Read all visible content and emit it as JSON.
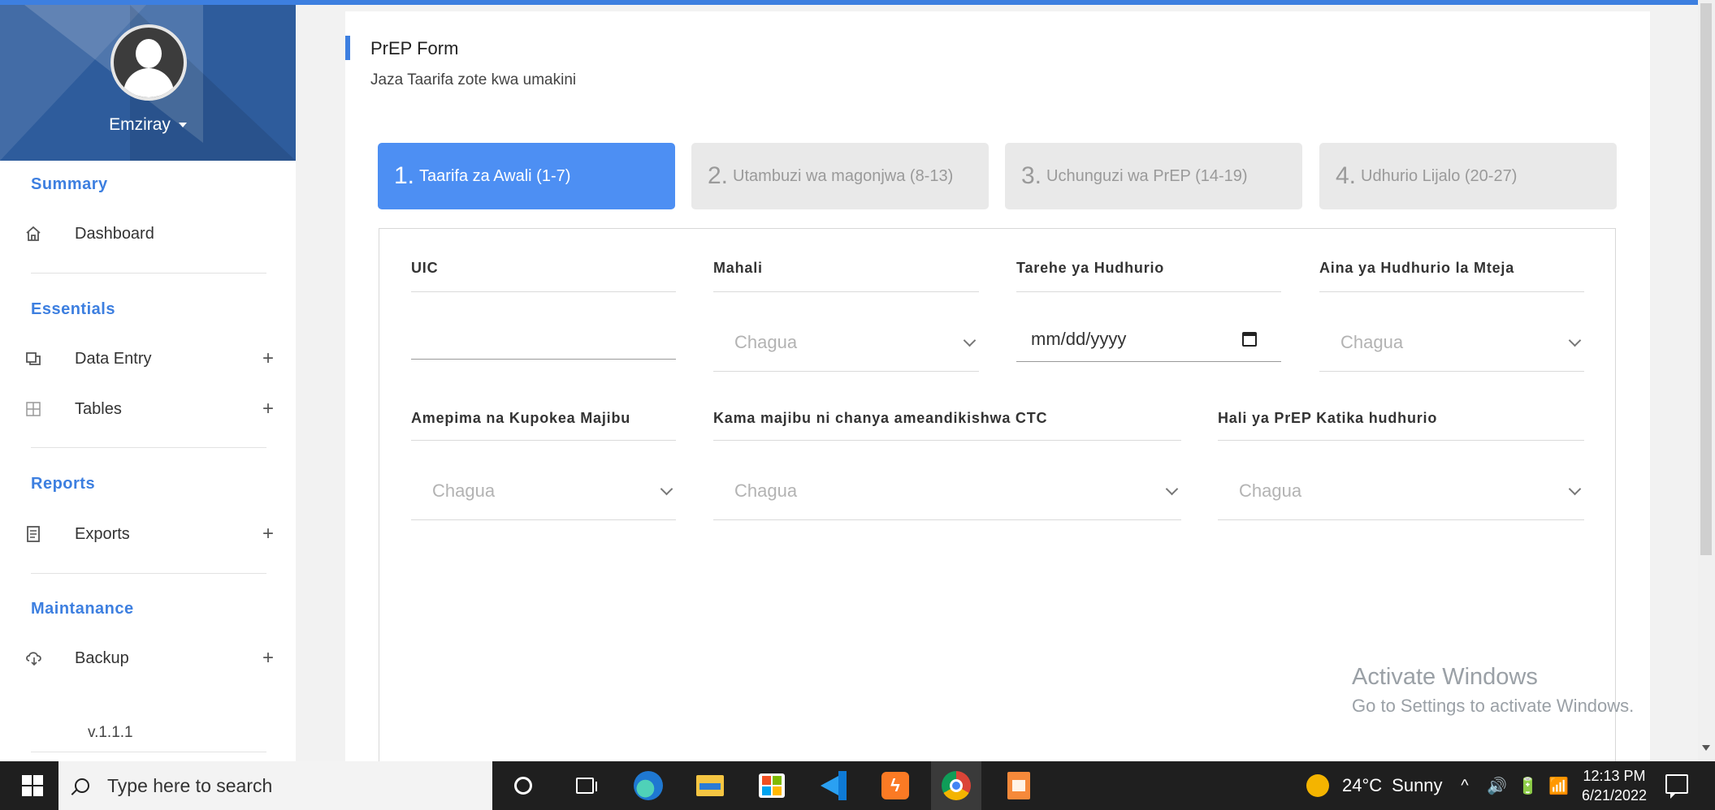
{
  "colors": {
    "accent": "#3d7fe0",
    "step_active": "#4d8ff3",
    "sidebar_profile_bg": "#2e5c9c",
    "taskbar_bg": "#1f1f1f"
  },
  "sidebar": {
    "username": "Emziray",
    "version": "v.1.1.1",
    "sections": [
      {
        "title": "Summary",
        "items": [
          {
            "label": "Dashboard",
            "icon": "home-icon",
            "expandable": false
          }
        ]
      },
      {
        "title": "Essentials",
        "items": [
          {
            "label": "Data Entry",
            "icon": "copy-icon",
            "expandable": true
          },
          {
            "label": "Tables",
            "icon": "table-icon",
            "expandable": true
          }
        ]
      },
      {
        "title": "Reports",
        "items": [
          {
            "label": "Exports",
            "icon": "document-icon",
            "expandable": true
          }
        ]
      },
      {
        "title": "Maintanance",
        "items": [
          {
            "label": "Backup",
            "icon": "cloud-icon",
            "expandable": true
          }
        ]
      }
    ],
    "expand_symbol": "+"
  },
  "header": {
    "title": "PrEP Form",
    "subtitle": "Jaza Taarifa zote kwa umakini"
  },
  "steps": [
    {
      "num": "1.",
      "label": "Taarifa za Awali (1-7)",
      "active": true
    },
    {
      "num": "2.",
      "label": "Utambuzi wa magonjwa (8-13)",
      "active": false
    },
    {
      "num": "3.",
      "label": "Uchunguzi wa PrEP (14-19)",
      "active": false
    },
    {
      "num": "4.",
      "label": "Udhurio Lijalo (20-27)",
      "active": false
    }
  ],
  "form": {
    "uic": {
      "label": "UIC",
      "value": ""
    },
    "mahali": {
      "label": "Mahali",
      "value": "Chagua"
    },
    "tarehe": {
      "label": "Tarehe ya Hudhurio",
      "value": "mm/dd/yyyy"
    },
    "aina": {
      "label": "Aina ya Hudhurio la Mteja",
      "value": "Chagua"
    },
    "amepima": {
      "label": "Amepima na Kupokea Majibu",
      "value": "Chagua"
    },
    "kama": {
      "label": "Kama majibu ni chanya ameandikishwa CTC",
      "value": "Chagua"
    },
    "hali": {
      "label": "Hali ya PrEP Katika hudhurio",
      "value": "Chagua"
    }
  },
  "watermark": {
    "title": "Activate Windows",
    "subtitle": "Go to Settings to activate Windows."
  },
  "taskbar": {
    "search_placeholder": "Type here to search",
    "apps": [
      "cortana-icon",
      "task-view-icon",
      "edge-icon",
      "file-explorer-icon",
      "store-icon",
      "vscode-icon",
      "xampp-icon",
      "chrome-icon",
      "document-app-icon"
    ],
    "weather": {
      "temp": "24°C",
      "condition": "Sunny"
    },
    "tray": {
      "chevron": "^",
      "volume": "🔊",
      "battery": "🔋",
      "wifi": "📶"
    },
    "time": "12:13 PM",
    "date": "6/21/2022"
  }
}
